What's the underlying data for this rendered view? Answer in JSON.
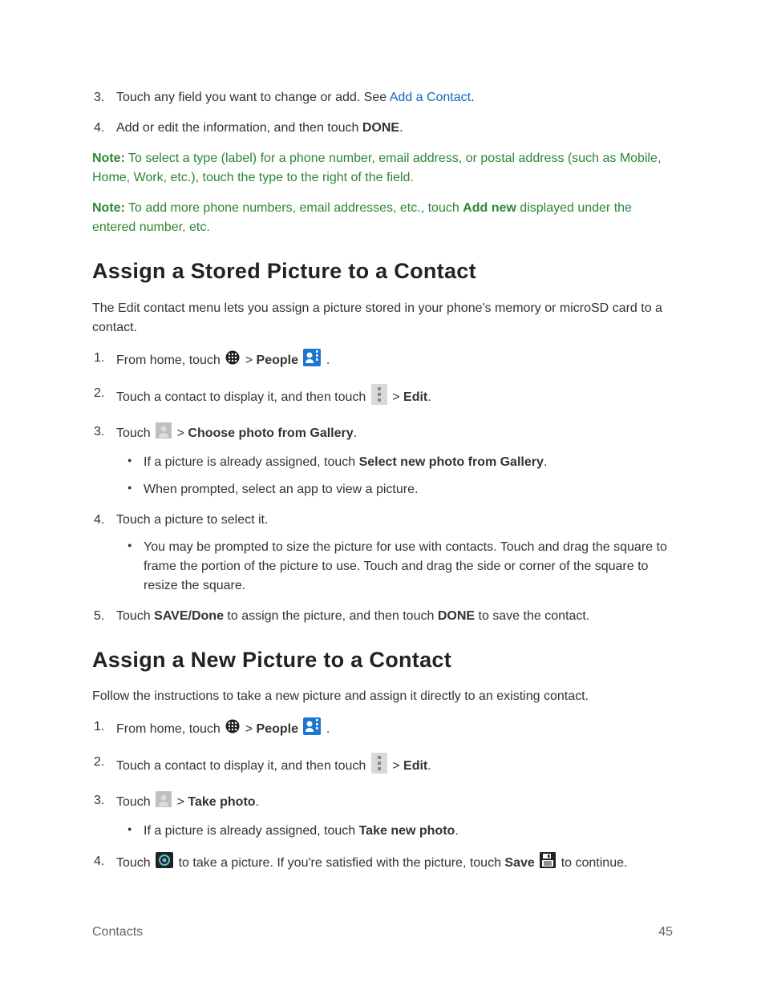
{
  "top_list": {
    "item3": {
      "num": "3.",
      "text_before": "Touch any field you want to change or add. See ",
      "link": "Add a Contact",
      "text_after": "."
    },
    "item4": {
      "num": "4.",
      "text_before": "Add or edit the information, and then touch ",
      "bold": "DONE",
      "text_after": "."
    }
  },
  "note1": {
    "label": "Note:",
    "text": " To select a type (label) for a phone number, email address, or postal address (such as Mobile, Home, Work, etc.), touch the type to the right of the field."
  },
  "note2": {
    "label": "Note:",
    "text_before": " To add more phone numbers, email addresses, etc., touch ",
    "bold": "Add new",
    "text_after": " displayed under the entered number, etc."
  },
  "section1": {
    "heading": "Assign a Stored Picture to a Contact",
    "intro": "The Edit contact menu lets you assign a picture stored in your phone's memory or microSD card to a contact.",
    "steps": {
      "s1": {
        "num": "1.",
        "t1": "From home, touch ",
        "t2": " > ",
        "bold": "People",
        "t3": " ",
        "t4": "."
      },
      "s2": {
        "num": "2.",
        "t1": "Touch a contact to display it, and then touch ",
        "t2": "  > ",
        "bold": "Edit",
        "t3": "."
      },
      "s3": {
        "num": "3.",
        "t1": "Touch ",
        "t2": " > ",
        "bold": "Choose photo from Gallery",
        "t3": ".",
        "b1": {
          "t1": "If a picture is already assigned, touch ",
          "bold": "Select new photo from Gallery",
          "t2": "."
        },
        "b2": "When prompted, select an app to view a picture."
      },
      "s4": {
        "num": "4.",
        "t1": "Touch a picture to select it.",
        "b1": "You may be prompted to size the picture for use with contacts. Touch and drag the square to frame the portion of the picture to use. Touch and drag the side or corner of the square to resize the square."
      },
      "s5": {
        "num": "5.",
        "t1": "Touch ",
        "bold1": "SAVE/Done",
        "t2": " to assign the picture, and then touch ",
        "bold2": "DONE",
        "t3": " to save the contact."
      }
    }
  },
  "section2": {
    "heading": "Assign a New Picture to a Contact",
    "intro": "Follow the instructions to take a new picture and assign it directly to an existing contact.",
    "steps": {
      "s1": {
        "num": "1.",
        "t1": "From home, touch ",
        "t2": " > ",
        "bold": "People",
        "t3": " ",
        "t4": "."
      },
      "s2": {
        "num": "2.",
        "t1": "Touch a contact to display it, and then touch ",
        "t2": "  > ",
        "bold": "Edit",
        "t3": "."
      },
      "s3": {
        "num": "3.",
        "t1": "Touch ",
        "t2": " > ",
        "bold": "Take photo",
        "t3": ".",
        "b1": {
          "t1": "If a picture is already assigned, touch ",
          "bold": "Take new photo",
          "t2": "."
        }
      },
      "s4": {
        "num": "4.",
        "t1": "Touch ",
        "t2": " to take a picture. If you're satisfied with the picture, touch ",
        "bold": "Save",
        "t3": " ",
        "t4": " to continue."
      }
    }
  },
  "footer": {
    "section": "Contacts",
    "page": "45"
  }
}
